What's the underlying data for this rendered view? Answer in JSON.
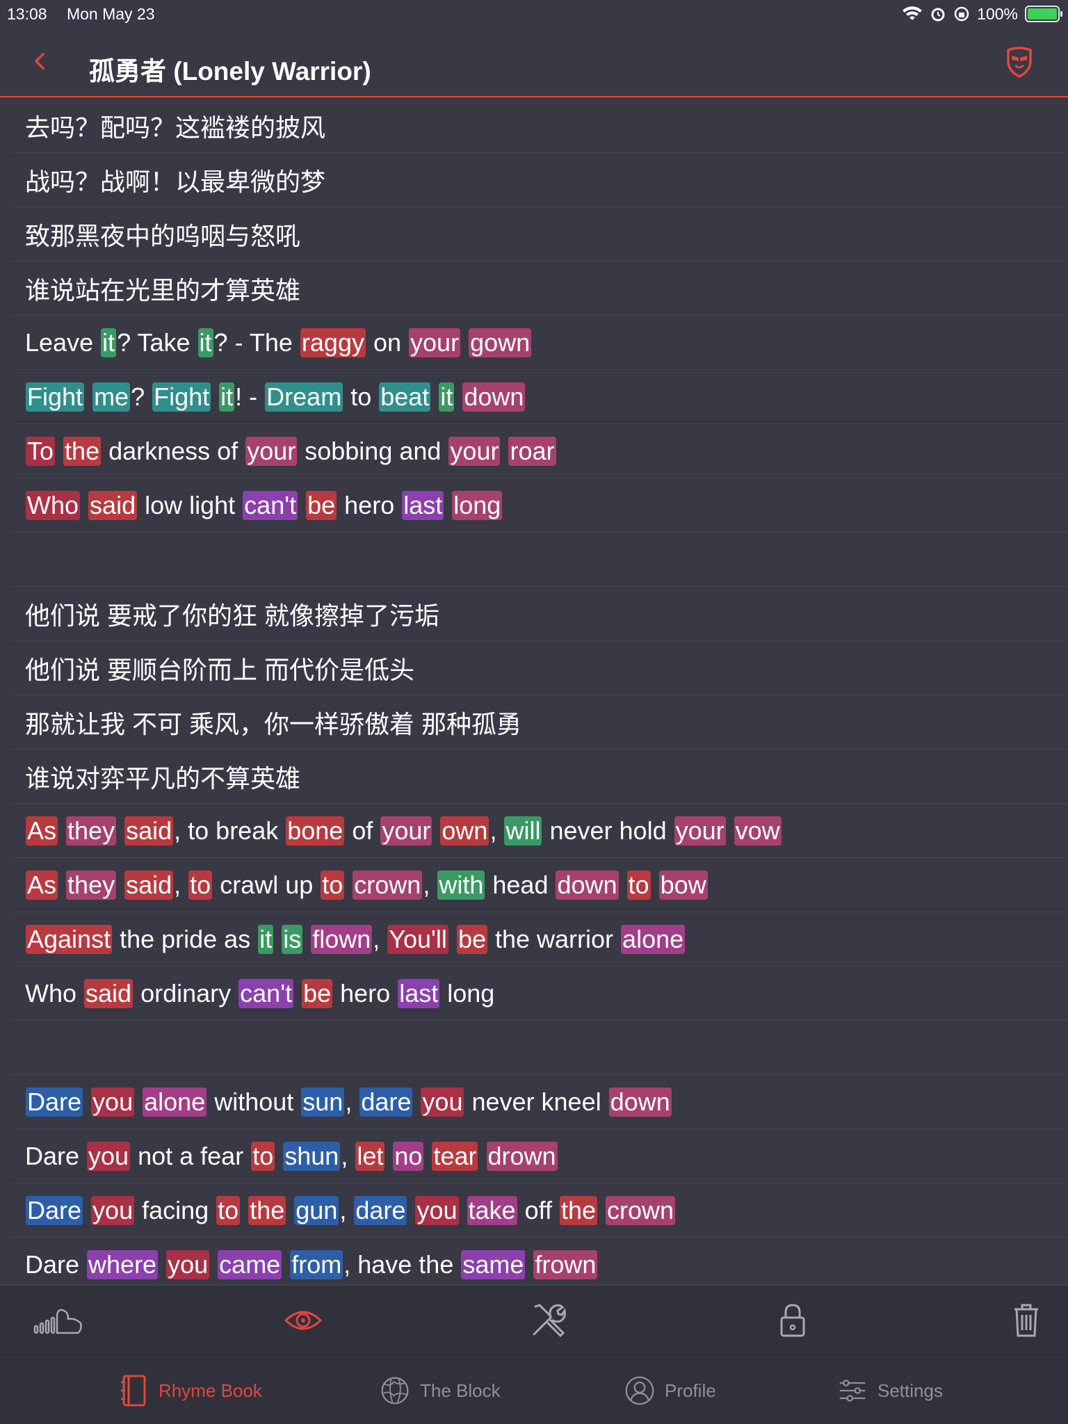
{
  "status": {
    "time": "13:08",
    "date": "Mon May 23",
    "battery": "100%"
  },
  "header": {
    "title": "孤勇者 (Lonely Warrior)"
  },
  "colors": {
    "accent": "#e1473f",
    "background": "#383944",
    "red": "#b83a3f",
    "crimson": "#a93045",
    "rose": "#a6416d",
    "magenta": "#a23d88",
    "violet": "#8c3fae",
    "green": "#3a9a64",
    "teal": "#2f8f8c",
    "blue": "#2d5fa8"
  },
  "lyrics": [
    [
      [
        "去吗？配吗？这褴褛的披风",
        null
      ]
    ],
    [
      [
        "战吗？战啊！以最卑微的梦",
        null
      ]
    ],
    [
      [
        "致那黑夜中的呜咽与怒吼",
        null
      ]
    ],
    [
      [
        "谁说站在光里的才算英雄",
        null
      ]
    ],
    [
      [
        "Leave ",
        null
      ],
      [
        "it",
        "green"
      ],
      [
        "? Take ",
        null
      ],
      [
        "it",
        "green"
      ],
      [
        "? - The ",
        null
      ],
      [
        "raggy",
        "red"
      ],
      [
        " on ",
        null
      ],
      [
        "your",
        "rose"
      ],
      [
        " ",
        null
      ],
      [
        "gown",
        "rose"
      ]
    ],
    [
      [
        "Fight",
        "teal"
      ],
      [
        " ",
        null
      ],
      [
        "me",
        "teal"
      ],
      [
        "? ",
        null
      ],
      [
        "Fight",
        "teal"
      ],
      [
        " ",
        null
      ],
      [
        "it",
        "green"
      ],
      [
        "! - ",
        null
      ],
      [
        "Dream",
        "teal"
      ],
      [
        " to ",
        null
      ],
      [
        "beat",
        "teal"
      ],
      [
        " ",
        null
      ],
      [
        "it",
        "green"
      ],
      [
        " ",
        null
      ],
      [
        "down",
        "rose"
      ]
    ],
    [
      [
        "To",
        "crimson"
      ],
      [
        " ",
        null
      ],
      [
        "the",
        "red"
      ],
      [
        " darkness of ",
        null
      ],
      [
        "your",
        "rose"
      ],
      [
        " sobbing and ",
        null
      ],
      [
        "your",
        "rose"
      ],
      [
        " ",
        null
      ],
      [
        "roar",
        "rose"
      ]
    ],
    [
      [
        "Who",
        "crimson"
      ],
      [
        " ",
        null
      ],
      [
        "said",
        "red"
      ],
      [
        " low light ",
        null
      ],
      [
        "can't",
        "violet"
      ],
      [
        " ",
        null
      ],
      [
        "be",
        "red"
      ],
      [
        " hero ",
        null
      ],
      [
        "last",
        "violet"
      ],
      [
        " ",
        null
      ],
      [
        "long",
        "rose"
      ]
    ],
    [],
    [
      [
        "他们说 要戒了你的狂 就像擦掉了污垢",
        null
      ]
    ],
    [
      [
        "他们说 要顺台阶而上 而代价是低头",
        null
      ]
    ],
    [
      [
        "那就让我 不可 乘风，你一样骄傲着 那种孤勇",
        null
      ]
    ],
    [
      [
        "谁说对弈平凡的不算英雄",
        null
      ]
    ],
    [
      [
        "As",
        "red"
      ],
      [
        " ",
        null
      ],
      [
        "they",
        "rose"
      ],
      [
        " ",
        null
      ],
      [
        "said",
        "red"
      ],
      [
        ", to break ",
        null
      ],
      [
        "bone",
        "red"
      ],
      [
        " of ",
        null
      ],
      [
        "your",
        "rose"
      ],
      [
        " ",
        null
      ],
      [
        "own",
        "red"
      ],
      [
        ", ",
        null
      ],
      [
        "will",
        "green"
      ],
      [
        " never hold ",
        null
      ],
      [
        "your",
        "rose"
      ],
      [
        " ",
        null
      ],
      [
        "vow",
        "rose"
      ]
    ],
    [
      [
        "As",
        "red"
      ],
      [
        " ",
        null
      ],
      [
        "they",
        "rose"
      ],
      [
        " ",
        null
      ],
      [
        "said",
        "red"
      ],
      [
        ", ",
        null
      ],
      [
        "to",
        "red"
      ],
      [
        " crawl up ",
        null
      ],
      [
        "to",
        "red"
      ],
      [
        " ",
        null
      ],
      [
        "crown",
        "rose"
      ],
      [
        ", ",
        null
      ],
      [
        "with",
        "green"
      ],
      [
        " head ",
        null
      ],
      [
        "down",
        "rose"
      ],
      [
        " ",
        null
      ],
      [
        "to",
        "red"
      ],
      [
        " ",
        null
      ],
      [
        "bow",
        "rose"
      ]
    ],
    [
      [
        "Against",
        "red"
      ],
      [
        " the pride as ",
        null
      ],
      [
        "it",
        "green"
      ],
      [
        " ",
        null
      ],
      [
        "is",
        "green"
      ],
      [
        " ",
        null
      ],
      [
        "flown",
        "magenta"
      ],
      [
        ", ",
        null
      ],
      [
        "You'll",
        "crimson"
      ],
      [
        " ",
        null
      ],
      [
        "be",
        "red"
      ],
      [
        " the warrior ",
        null
      ],
      [
        "alone",
        "magenta"
      ]
    ],
    [
      [
        "Who ",
        null
      ],
      [
        "said",
        "red"
      ],
      [
        " ordinary ",
        null
      ],
      [
        "can't",
        "violet"
      ],
      [
        " ",
        null
      ],
      [
        "be",
        "red"
      ],
      [
        " hero ",
        null
      ],
      [
        "last",
        "violet"
      ],
      [
        " long",
        null
      ]
    ],
    [],
    [
      [
        "Dare",
        "blue"
      ],
      [
        " ",
        null
      ],
      [
        "you",
        "crimson"
      ],
      [
        " ",
        null
      ],
      [
        "alone",
        "magenta"
      ],
      [
        " without ",
        null
      ],
      [
        "sun",
        "blue"
      ],
      [
        ", ",
        null
      ],
      [
        "dare",
        "blue"
      ],
      [
        " ",
        null
      ],
      [
        "you",
        "crimson"
      ],
      [
        " never kneel ",
        null
      ],
      [
        "down",
        "rose"
      ]
    ],
    [
      [
        "Dare ",
        null
      ],
      [
        "you",
        "crimson"
      ],
      [
        " not a fear ",
        null
      ],
      [
        "to",
        "red"
      ],
      [
        " ",
        null
      ],
      [
        "shun",
        "blue"
      ],
      [
        ", ",
        null
      ],
      [
        "let",
        "red"
      ],
      [
        " ",
        null
      ],
      [
        "no",
        "magenta"
      ],
      [
        " ",
        null
      ],
      [
        "tear",
        "red"
      ],
      [
        " ",
        null
      ],
      [
        "drown",
        "rose"
      ]
    ],
    [
      [
        "Dare",
        "blue"
      ],
      [
        " ",
        null
      ],
      [
        "you",
        "crimson"
      ],
      [
        " facing ",
        null
      ],
      [
        "to",
        "red"
      ],
      [
        " ",
        null
      ],
      [
        "the",
        "red"
      ],
      [
        " ",
        null
      ],
      [
        "gun",
        "blue"
      ],
      [
        ", ",
        null
      ],
      [
        "dare",
        "blue"
      ],
      [
        " ",
        null
      ],
      [
        "you",
        "crimson"
      ],
      [
        " ",
        null
      ],
      [
        "take",
        "magenta"
      ],
      [
        " off ",
        null
      ],
      [
        "the",
        "red"
      ],
      [
        " ",
        null
      ],
      [
        "crown",
        "rose"
      ]
    ],
    [
      [
        "Dare ",
        null
      ],
      [
        "where",
        "violet"
      ],
      [
        " ",
        null
      ],
      [
        "you",
        "crimson"
      ],
      [
        " ",
        null
      ],
      [
        "came",
        "violet"
      ],
      [
        " ",
        null
      ],
      [
        "from",
        "blue"
      ],
      [
        ", have the ",
        null
      ],
      [
        "same",
        "violet"
      ],
      [
        " ",
        null
      ],
      [
        "frown",
        "rose"
      ]
    ]
  ],
  "toolbar": {
    "icons": [
      "signal-wave-icon",
      "eye-icon",
      "tools-icon",
      "lock-icon",
      "trash-icon"
    ]
  },
  "tabs": [
    {
      "label": "Rhyme Book",
      "icon": "notebook-icon",
      "active": true
    },
    {
      "label": "The Block",
      "icon": "globe-icon",
      "active": false
    },
    {
      "label": "Profile",
      "icon": "person-icon",
      "active": false
    },
    {
      "label": "Settings",
      "icon": "sliders-icon",
      "active": false
    }
  ]
}
